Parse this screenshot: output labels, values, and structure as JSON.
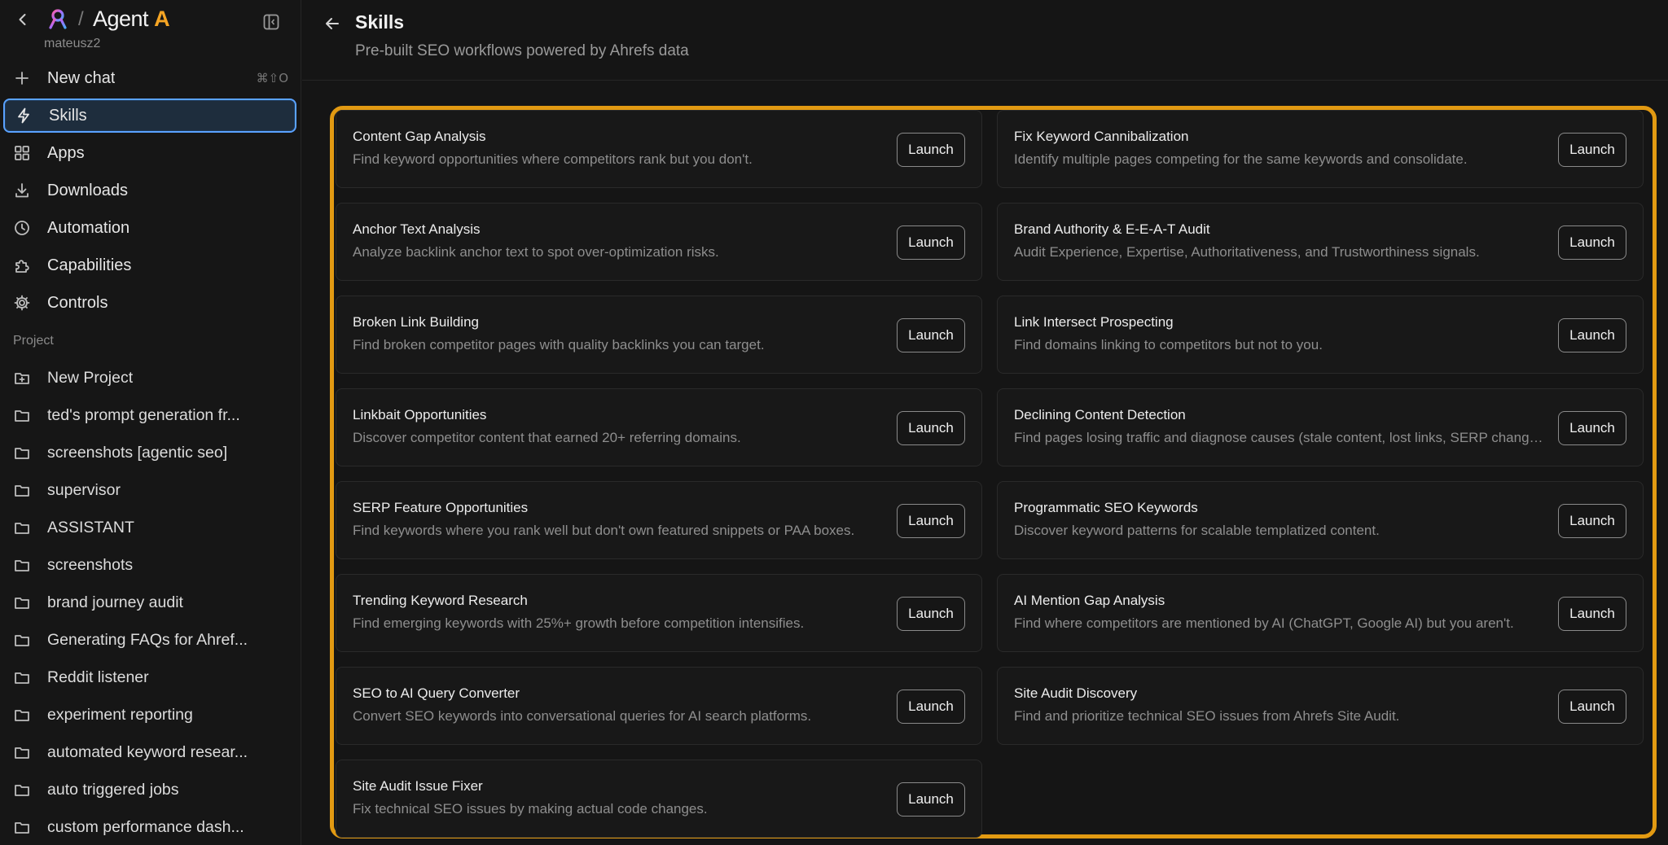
{
  "sidebar": {
    "brand_prefix": "Agent ",
    "brand_accent": "A",
    "user": "mateusz2",
    "nav": [
      {
        "label": "New chat",
        "shortcut": "⌘⇧O",
        "icon": "plus-icon"
      },
      {
        "label": "Skills",
        "icon": "bolt-icon",
        "active": true
      },
      {
        "label": "Apps",
        "icon": "grid-icon"
      },
      {
        "label": "Downloads",
        "icon": "download-icon"
      },
      {
        "label": "Automation",
        "icon": "clock-icon"
      },
      {
        "label": "Capabilities",
        "icon": "puzzle-icon"
      },
      {
        "label": "Controls",
        "icon": "gear-icon"
      }
    ],
    "project_section": "Project",
    "projects": [
      "New Project",
      "ted's prompt generation fr...",
      "screenshots [agentic seo]",
      "supervisor",
      "ASSISTANT",
      "screenshots",
      "brand journey audit",
      "Generating FAQs for Ahref...",
      "Reddit listener",
      "experiment reporting",
      "automated keyword resear...",
      "auto triggered jobs",
      "custom performance dash..."
    ]
  },
  "header": {
    "title": "Skills",
    "subtitle": "Pre-built SEO workflows powered by Ahrefs data"
  },
  "launch_label": "Launch",
  "skills": [
    {
      "title": "Content Gap Analysis",
      "desc": "Find keyword opportunities where competitors rank but you don't."
    },
    {
      "title": "Fix Keyword Cannibalization",
      "desc": "Identify multiple pages competing for the same keywords and consolidate."
    },
    {
      "title": "Anchor Text Analysis",
      "desc": "Analyze backlink anchor text to spot over-optimization risks."
    },
    {
      "title": "Brand Authority & E-E-A-T Audit",
      "desc": "Audit Experience, Expertise, Authoritativeness, and Trustworthiness signals."
    },
    {
      "title": "Broken Link Building",
      "desc": "Find broken competitor pages with quality backlinks you can target."
    },
    {
      "title": "Link Intersect Prospecting",
      "desc": "Find domains linking to competitors but not to you."
    },
    {
      "title": "Linkbait Opportunities",
      "desc": "Discover competitor content that earned 20+ referring domains."
    },
    {
      "title": "Declining Content Detection",
      "desc": "Find pages losing traffic and diagnose causes (stale content, lost links, SERP changes)."
    },
    {
      "title": "SERP Feature Opportunities",
      "desc": "Find keywords where you rank well but don't own featured snippets or PAA boxes."
    },
    {
      "title": "Programmatic SEO Keywords",
      "desc": "Discover keyword patterns for scalable templatized content."
    },
    {
      "title": "Trending Keyword Research",
      "desc": "Find emerging keywords with 25%+ growth before competition intensifies."
    },
    {
      "title": "AI Mention Gap Analysis",
      "desc": "Find where competitors are mentioned by AI (ChatGPT, Google AI) but you aren't."
    },
    {
      "title": "SEO to AI Query Converter",
      "desc": "Convert SEO keywords into conversational queries for AI search platforms."
    },
    {
      "title": "Site Audit Discovery",
      "desc": "Find and prioritize technical SEO issues from Ahrefs Site Audit."
    },
    {
      "title": "Site Audit Issue Fixer",
      "desc": "Fix technical SEO issues by making actual code changes."
    }
  ],
  "colors": {
    "accent": "#e29a12",
    "active_border": "#5aa2ff",
    "brand_accent": "#f5a524"
  }
}
